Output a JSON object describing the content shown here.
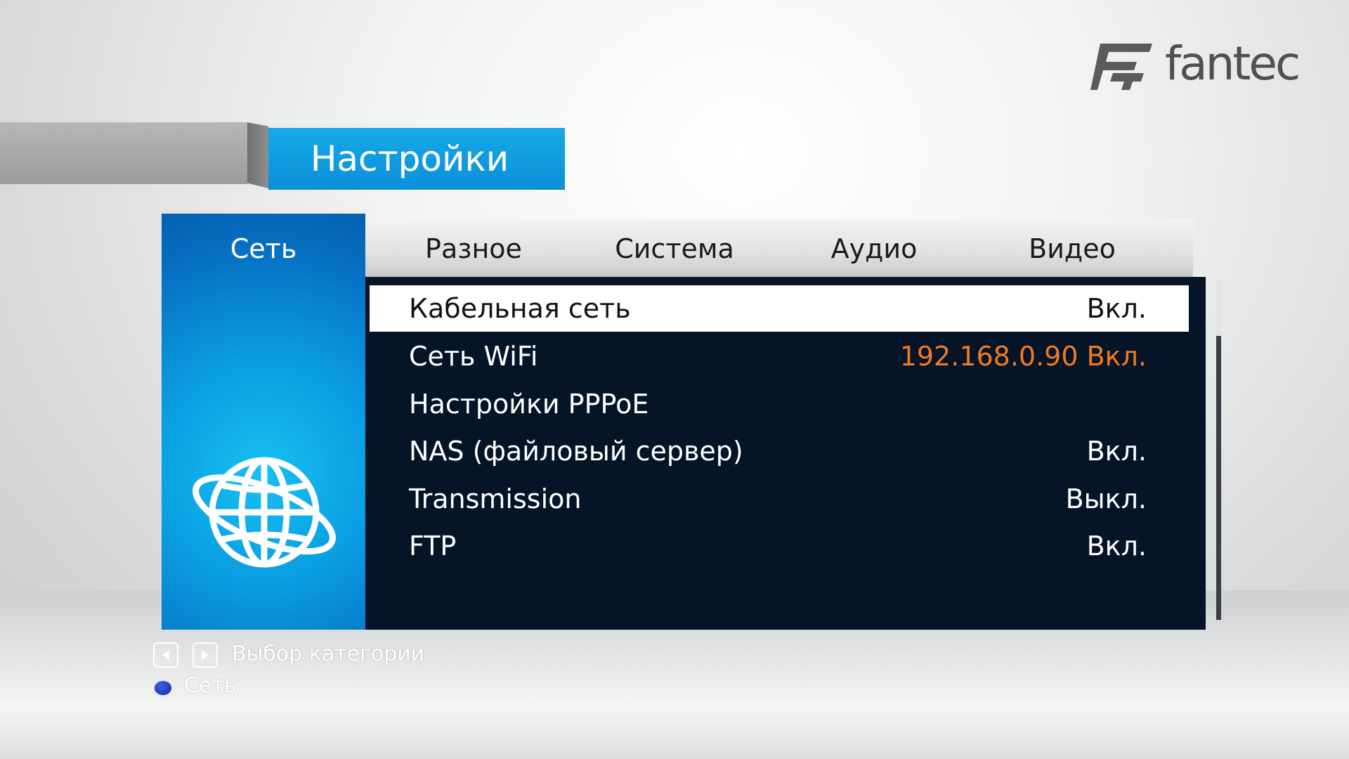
{
  "brand": {
    "logo_text": "fantec",
    "logo_mark_letter": "F"
  },
  "header": {
    "title": "Настройки"
  },
  "category": {
    "selected_label": "Сеть",
    "icon": "globe-icon"
  },
  "tabs": [
    {
      "label": "Разное"
    },
    {
      "label": "Система"
    },
    {
      "label": "Аудио"
    },
    {
      "label": "Видео"
    }
  ],
  "settings": [
    {
      "label": "Кабельная сеть",
      "value": "Вкл.",
      "selected": true
    },
    {
      "label": "Сеть WiFi",
      "value": "192.168.0.90 Вкл.",
      "highlight": true
    },
    {
      "label": "Настройки PPPoE",
      "value": ""
    },
    {
      "label": "NAS (файловый сервер)",
      "value": "Вкл."
    },
    {
      "label": "Transmission",
      "value": "Выкл."
    },
    {
      "label": "FTP",
      "value": "Вкл."
    }
  ],
  "hints": {
    "category_select": "Выбор категории",
    "current": "Сеть",
    "left_key_icon": "arrow-left-icon",
    "right_key_icon": "arrow-right-icon"
  },
  "colors": {
    "accent_blue": "#0b8fd9",
    "panel_dark": "#061428",
    "highlight_orange": "#f07a1e"
  }
}
